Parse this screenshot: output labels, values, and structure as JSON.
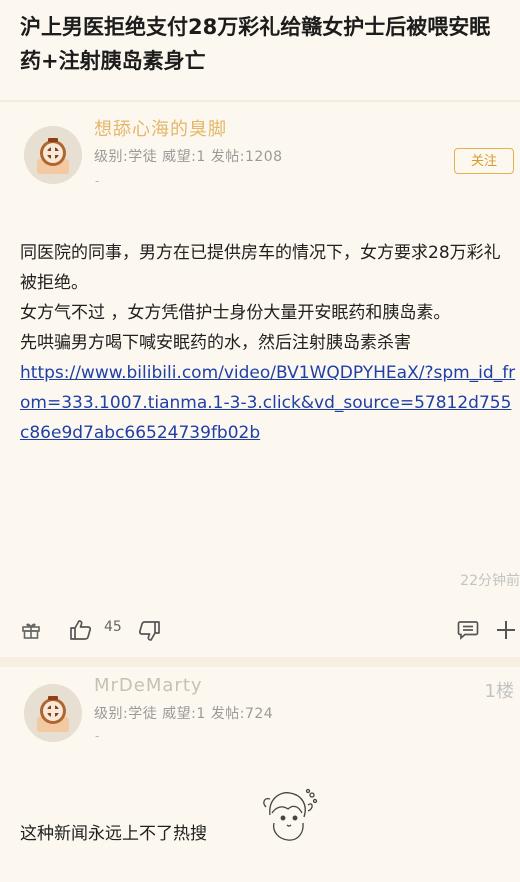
{
  "thread": {
    "title": "沪上男医拒绝支付28万彩礼给赣女护士后被喂安眠药+注射胰岛素身亡"
  },
  "post": {
    "author": "想舔心海的臭脚",
    "meta": "级别:学徒 威望:1 发帖:1208",
    "signature": "-",
    "follow_label": "关注",
    "paragraphs": [
      "同医院的同事，男方在已提供房车的情况下，女方要求28万彩礼被拒绝。",
      "女方气不过 ，女方凭借护士身份大量开安眠药和胰岛素。",
      "先哄骗男方喝下喊安眠药的水，然后注射胰岛素杀害"
    ],
    "link": "https://www.bilibili.com/video/BV1WQDPYHEaX/?spm_id_from=333.1007.tianma.1-3-3.click&vd_source=57812d755c86e9d7abc66524739fb02b",
    "time": "22分钟前",
    "like_count": "45",
    "icons": [
      "gift-icon",
      "thumbs-up-icon",
      "thumbs-down-icon",
      "comment-icon",
      "plus-icon"
    ]
  },
  "reply": {
    "author": "MrDeMarty",
    "floor": "1楼",
    "meta": "级别:学徒 威望:1 发帖:724",
    "signature": "-",
    "text": "这种新闻永远上不了热搜"
  },
  "colors": {
    "background": "#fdf8ef",
    "username": "#e2b76a",
    "follow": "#d89a2c",
    "link": "#1e3fa8"
  }
}
